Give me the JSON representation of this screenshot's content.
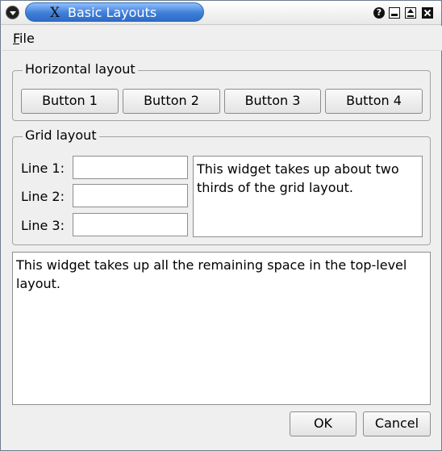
{
  "window": {
    "title": "Basic Layouts",
    "title_icon": "X",
    "help_label": "?"
  },
  "menu": {
    "file_first": "F",
    "file_rest": "ile"
  },
  "horizontal_group": {
    "title": "Horizontal layout",
    "buttons": [
      "Button 1",
      "Button 2",
      "Button 3",
      "Button 4"
    ]
  },
  "grid_group": {
    "title": "Grid layout",
    "lines": [
      "Line 1:",
      "Line 2:",
      "Line 3:"
    ],
    "line_values": [
      "",
      "",
      ""
    ],
    "side_text": "This widget takes up about two thirds of the grid layout."
  },
  "big_text": "This widget takes up all the remaining space in the top-level layout.",
  "footer": {
    "ok_label": "OK",
    "cancel_label": "Cancel"
  }
}
